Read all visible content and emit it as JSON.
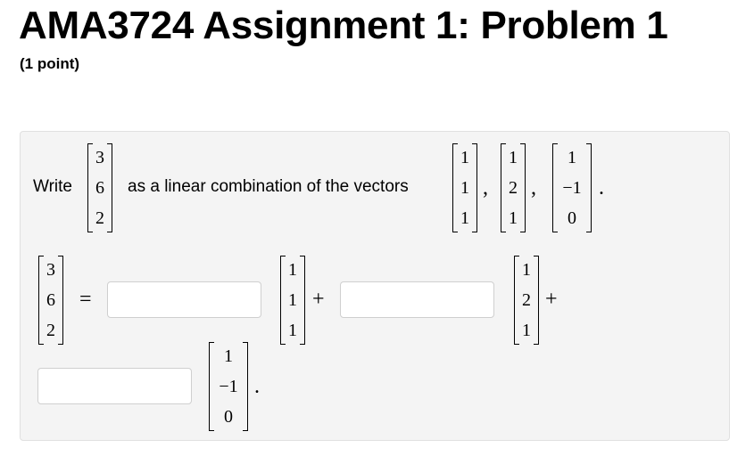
{
  "header": {
    "title": "AMA3724 Assignment 1: Problem 1",
    "points": "(1 point)"
  },
  "problem": {
    "prefix": "Write",
    "middle": "as a linear combination of the vectors",
    "target": [
      "3",
      "6",
      "2"
    ],
    "v1": [
      "1",
      "1",
      "1"
    ],
    "v2": [
      "1",
      "2",
      "1"
    ],
    "v3": [
      "1",
      "−1",
      "0"
    ],
    "comma": ",",
    "period": ".",
    "equals": "=",
    "plus": "+"
  },
  "answers": {
    "a1": "",
    "a2": "",
    "a3": ""
  }
}
